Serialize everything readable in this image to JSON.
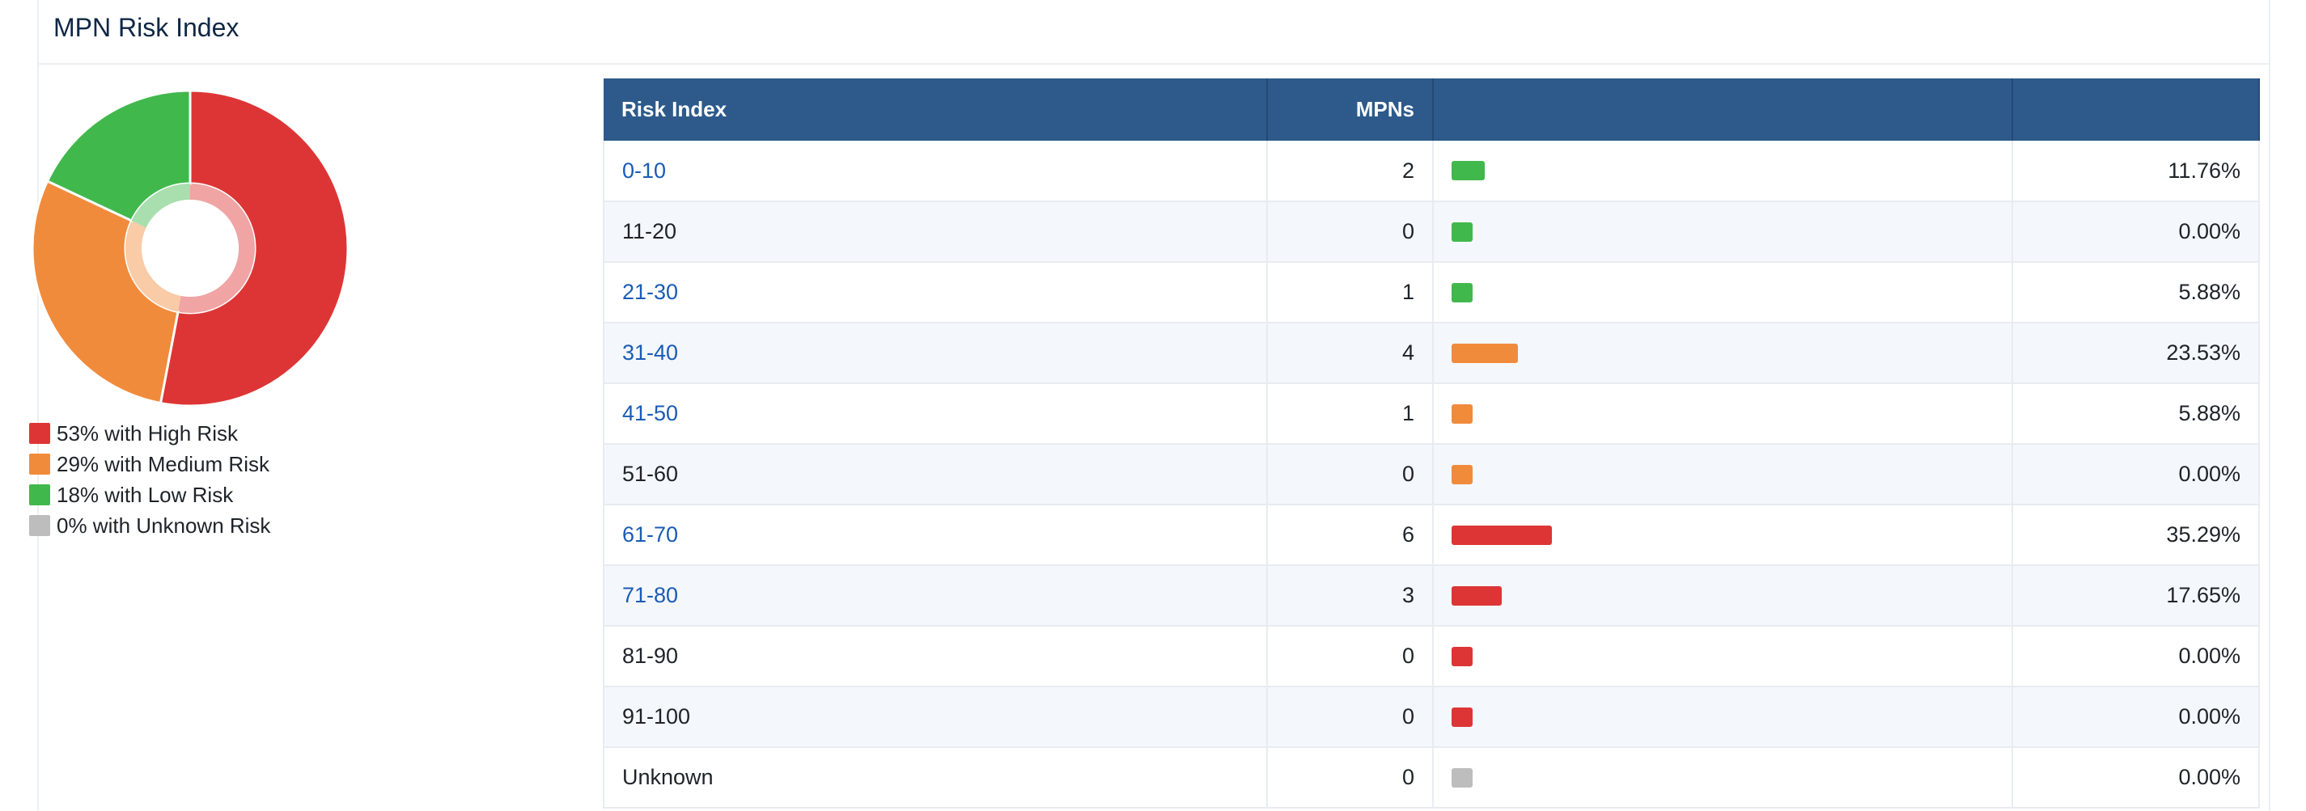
{
  "panel": {
    "title": "MPN Risk Index"
  },
  "chart_data": {
    "type": "pie",
    "categories": [
      "High Risk",
      "Medium Risk",
      "Low Risk",
      "Unknown Risk"
    ],
    "values": [
      53,
      29,
      18,
      0
    ],
    "colors": [
      "#dd3535",
      "#f18b3c",
      "#41b84c",
      "#bdbdbd"
    ]
  },
  "legend": [
    {
      "label": "53% with High Risk",
      "color": "#dd3535"
    },
    {
      "label": "29% with Medium Risk",
      "color": "#f18b3c"
    },
    {
      "label": "18% with Low Risk",
      "color": "#41b84c"
    },
    {
      "label": "0% with Unknown Risk",
      "color": "#bdbdbd"
    }
  ],
  "table": {
    "headers": {
      "risk_index": "Risk Index",
      "mpns": "MPNs",
      "bar": "",
      "percent": ""
    },
    "rows": [
      {
        "range": "0-10",
        "mpns": "2",
        "percent": "11.76%",
        "share": 0.1176,
        "color": "#41b84c",
        "link": true
      },
      {
        "range": "11-20",
        "mpns": "0",
        "percent": "0.00%",
        "share": 0,
        "color": "#41b84c",
        "link": false
      },
      {
        "range": "21-30",
        "mpns": "1",
        "percent": "5.88%",
        "share": 0.0588,
        "color": "#41b84c",
        "link": true
      },
      {
        "range": "31-40",
        "mpns": "4",
        "percent": "23.53%",
        "share": 0.2353,
        "color": "#f18b3c",
        "link": true
      },
      {
        "range": "41-50",
        "mpns": "1",
        "percent": "5.88%",
        "share": 0.0588,
        "color": "#f18b3c",
        "link": true
      },
      {
        "range": "51-60",
        "mpns": "0",
        "percent": "0.00%",
        "share": 0,
        "color": "#f18b3c",
        "link": false
      },
      {
        "range": "61-70",
        "mpns": "6",
        "percent": "35.29%",
        "share": 0.3529,
        "color": "#dd3535",
        "link": true
      },
      {
        "range": "71-80",
        "mpns": "3",
        "percent": "17.65%",
        "share": 0.1765,
        "color": "#dd3535",
        "link": true
      },
      {
        "range": "81-90",
        "mpns": "0",
        "percent": "0.00%",
        "share": 0,
        "color": "#dd3535",
        "link": false
      },
      {
        "range": "91-100",
        "mpns": "0",
        "percent": "0.00%",
        "share": 0,
        "color": "#dd3535",
        "link": false
      },
      {
        "range": "Unknown",
        "mpns": "0",
        "percent": "0.00%",
        "share": 0,
        "color": "#bdbdbd",
        "link": false
      }
    ]
  }
}
